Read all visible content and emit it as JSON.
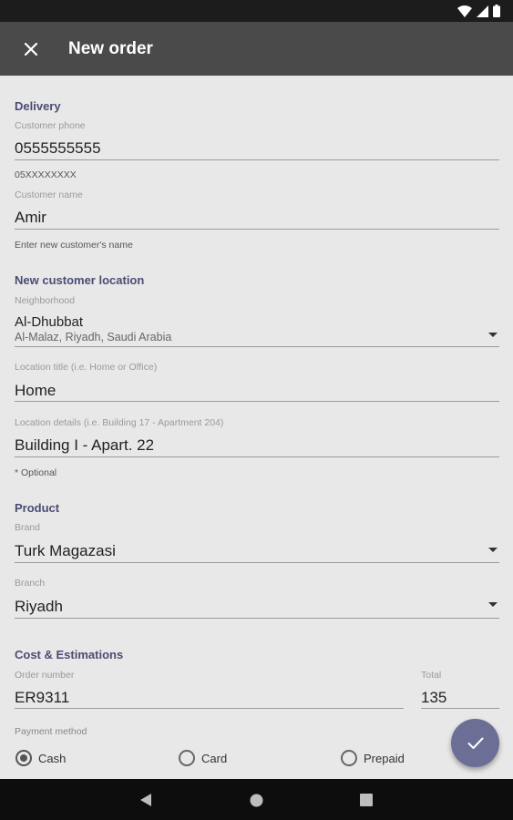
{
  "app_bar": {
    "title": "New order",
    "close_icon": "close-icon"
  },
  "status_bar": {
    "icons": [
      "wifi-icon",
      "signal-icon",
      "battery-icon"
    ]
  },
  "delivery": {
    "section_title": "Delivery",
    "customer_phone": {
      "hint": "Customer phone",
      "value": "0555555555",
      "helper": "05XXXXXXXX"
    },
    "customer_name": {
      "hint": "Customer name",
      "value": "Amir",
      "helper": "Enter new customer's name"
    }
  },
  "location": {
    "section_title": "New customer location",
    "neighborhood": {
      "hint": "Neighborhood",
      "value": "Al-Dhubbat",
      "subvalue": "Al-Malaz, Riyadh, Saudi Arabia"
    },
    "location_title": {
      "hint": "Location title (i.e. Home or Office)",
      "value": "Home"
    },
    "location_details": {
      "hint": "Location details (i.e. Building 17 - Apartment 204)",
      "value": "Building I - Apart. 22",
      "helper": "* Optional"
    }
  },
  "product": {
    "section_title": "Product",
    "brand": {
      "hint": "Brand",
      "value": "Turk Magazasi"
    },
    "branch": {
      "hint": "Branch",
      "value": "Riyadh"
    }
  },
  "cost": {
    "section_title": "Cost & Estimations",
    "order_number": {
      "hint": "Order number",
      "value": "ER9311"
    },
    "total": {
      "hint": "Total",
      "value": "135"
    },
    "payment_method": {
      "label": "Payment method",
      "options": [
        {
          "label": "Cash",
          "checked": true
        },
        {
          "label": "Card",
          "checked": false
        },
        {
          "label": "Prepaid",
          "checked": false
        }
      ]
    }
  },
  "fab_icon": "check-icon",
  "nav": {
    "icons": [
      "back-icon",
      "home-icon",
      "recents-icon"
    ]
  },
  "colors": {
    "accent": "#4b4c74",
    "fab": "#6b6e95",
    "app_bar": "#4a4a4a"
  }
}
